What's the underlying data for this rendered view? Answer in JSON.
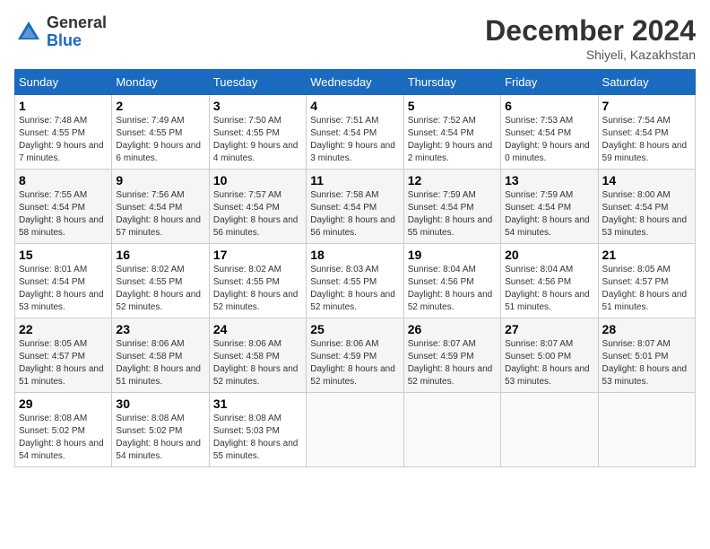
{
  "logo": {
    "general": "General",
    "blue": "Blue"
  },
  "header": {
    "month": "December 2024",
    "location": "Shiyeli, Kazakhstan"
  },
  "weekdays": [
    "Sunday",
    "Monday",
    "Tuesday",
    "Wednesday",
    "Thursday",
    "Friday",
    "Saturday"
  ],
  "weeks": [
    [
      {
        "day": "1",
        "sunrise": "7:48 AM",
        "sunset": "4:55 PM",
        "daylight": "9 hours and 7 minutes."
      },
      {
        "day": "2",
        "sunrise": "7:49 AM",
        "sunset": "4:55 PM",
        "daylight": "9 hours and 6 minutes."
      },
      {
        "day": "3",
        "sunrise": "7:50 AM",
        "sunset": "4:55 PM",
        "daylight": "9 hours and 4 minutes."
      },
      {
        "day": "4",
        "sunrise": "7:51 AM",
        "sunset": "4:54 PM",
        "daylight": "9 hours and 3 minutes."
      },
      {
        "day": "5",
        "sunrise": "7:52 AM",
        "sunset": "4:54 PM",
        "daylight": "9 hours and 2 minutes."
      },
      {
        "day": "6",
        "sunrise": "7:53 AM",
        "sunset": "4:54 PM",
        "daylight": "9 hours and 0 minutes."
      },
      {
        "day": "7",
        "sunrise": "7:54 AM",
        "sunset": "4:54 PM",
        "daylight": "8 hours and 59 minutes."
      }
    ],
    [
      {
        "day": "8",
        "sunrise": "7:55 AM",
        "sunset": "4:54 PM",
        "daylight": "8 hours and 58 minutes."
      },
      {
        "day": "9",
        "sunrise": "7:56 AM",
        "sunset": "4:54 PM",
        "daylight": "8 hours and 57 minutes."
      },
      {
        "day": "10",
        "sunrise": "7:57 AM",
        "sunset": "4:54 PM",
        "daylight": "8 hours and 56 minutes."
      },
      {
        "day": "11",
        "sunrise": "7:58 AM",
        "sunset": "4:54 PM",
        "daylight": "8 hours and 56 minutes."
      },
      {
        "day": "12",
        "sunrise": "7:59 AM",
        "sunset": "4:54 PM",
        "daylight": "8 hours and 55 minutes."
      },
      {
        "day": "13",
        "sunrise": "7:59 AM",
        "sunset": "4:54 PM",
        "daylight": "8 hours and 54 minutes."
      },
      {
        "day": "14",
        "sunrise": "8:00 AM",
        "sunset": "4:54 PM",
        "daylight": "8 hours and 53 minutes."
      }
    ],
    [
      {
        "day": "15",
        "sunrise": "8:01 AM",
        "sunset": "4:54 PM",
        "daylight": "8 hours and 53 minutes."
      },
      {
        "day": "16",
        "sunrise": "8:02 AM",
        "sunset": "4:55 PM",
        "daylight": "8 hours and 52 minutes."
      },
      {
        "day": "17",
        "sunrise": "8:02 AM",
        "sunset": "4:55 PM",
        "daylight": "8 hours and 52 minutes."
      },
      {
        "day": "18",
        "sunrise": "8:03 AM",
        "sunset": "4:55 PM",
        "daylight": "8 hours and 52 minutes."
      },
      {
        "day": "19",
        "sunrise": "8:04 AM",
        "sunset": "4:56 PM",
        "daylight": "8 hours and 52 minutes."
      },
      {
        "day": "20",
        "sunrise": "8:04 AM",
        "sunset": "4:56 PM",
        "daylight": "8 hours and 51 minutes."
      },
      {
        "day": "21",
        "sunrise": "8:05 AM",
        "sunset": "4:57 PM",
        "daylight": "8 hours and 51 minutes."
      }
    ],
    [
      {
        "day": "22",
        "sunrise": "8:05 AM",
        "sunset": "4:57 PM",
        "daylight": "8 hours and 51 minutes."
      },
      {
        "day": "23",
        "sunrise": "8:06 AM",
        "sunset": "4:58 PM",
        "daylight": "8 hours and 51 minutes."
      },
      {
        "day": "24",
        "sunrise": "8:06 AM",
        "sunset": "4:58 PM",
        "daylight": "8 hours and 52 minutes."
      },
      {
        "day": "25",
        "sunrise": "8:06 AM",
        "sunset": "4:59 PM",
        "daylight": "8 hours and 52 minutes."
      },
      {
        "day": "26",
        "sunrise": "8:07 AM",
        "sunset": "4:59 PM",
        "daylight": "8 hours and 52 minutes."
      },
      {
        "day": "27",
        "sunrise": "8:07 AM",
        "sunset": "5:00 PM",
        "daylight": "8 hours and 53 minutes."
      },
      {
        "day": "28",
        "sunrise": "8:07 AM",
        "sunset": "5:01 PM",
        "daylight": "8 hours and 53 minutes."
      }
    ],
    [
      {
        "day": "29",
        "sunrise": "8:08 AM",
        "sunset": "5:02 PM",
        "daylight": "8 hours and 54 minutes."
      },
      {
        "day": "30",
        "sunrise": "8:08 AM",
        "sunset": "5:02 PM",
        "daylight": "8 hours and 54 minutes."
      },
      {
        "day": "31",
        "sunrise": "8:08 AM",
        "sunset": "5:03 PM",
        "daylight": "8 hours and 55 minutes."
      },
      null,
      null,
      null,
      null
    ]
  ],
  "labels": {
    "sunrise": "Sunrise:",
    "sunset": "Sunset:",
    "daylight": "Daylight:"
  }
}
